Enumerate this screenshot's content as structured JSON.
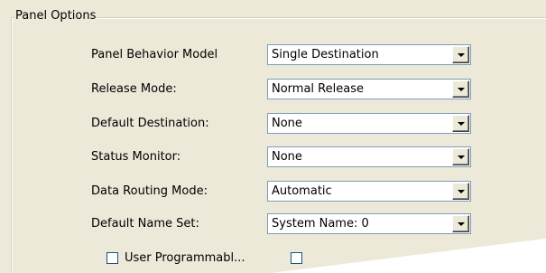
{
  "panel": {
    "title": "Panel Options"
  },
  "rows": [
    {
      "label": "Panel Behavior Model",
      "value": "Single Destination"
    },
    {
      "label": "Release Mode:",
      "value": "Normal Release"
    },
    {
      "label": "Default Destination:",
      "value": "None"
    },
    {
      "label": "Status Monitor:",
      "value": "None"
    },
    {
      "label": "Data Routing Mode:",
      "value": "Automatic"
    },
    {
      "label": "Default Name Set:",
      "value": "System Name: 0"
    }
  ],
  "checkboxes": [
    {
      "label": "User Programmabl...",
      "checked": false
    },
    {
      "label": "",
      "checked": false
    }
  ],
  "icons": {
    "dropdown": "chevron-down-icon"
  },
  "colors": {
    "background": "#ece9d8",
    "combo_border": "#7f9db9"
  }
}
